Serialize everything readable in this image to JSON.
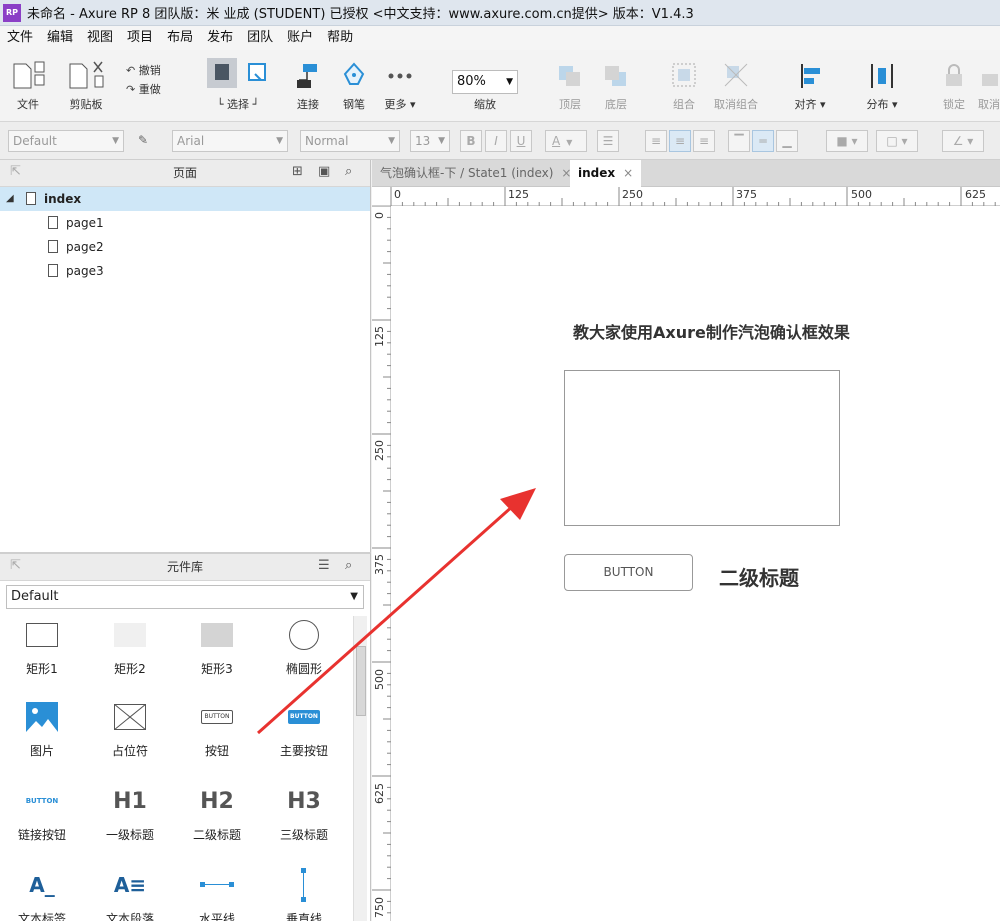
{
  "window": {
    "logo": "RP",
    "title": "未命名 - Axure RP 8 团队版：米 业成 (STUDENT) 已授权     <中文支持：www.axure.com.cn提供> 版本：V1.4.3"
  },
  "menu": [
    "文件",
    "编辑",
    "视图",
    "项目",
    "布局",
    "发布",
    "团队",
    "账户",
    "帮助"
  ],
  "toolbar": {
    "file": "文件",
    "clipboard": "剪贴板",
    "undo": "撤销",
    "redo": "重做",
    "select": "选择",
    "connect": "连接",
    "pen": "钢笔",
    "more": "更多 ▾",
    "zoom_value": "80%",
    "zoom_label": "缩放",
    "top": "顶层",
    "bottom": "底层",
    "group": "组合",
    "ungroup": "取消组合",
    "align": "对齐 ▾",
    "distribute": "分布 ▾",
    "lock": "锁定",
    "unlock": "取消"
  },
  "format": {
    "style": "Default",
    "font": "Arial",
    "weight": "Normal",
    "size": "13",
    "bold": "B",
    "italic": "I",
    "underline": "U",
    "font_color": "A"
  },
  "pages_panel": {
    "title": "页面",
    "root": "index",
    "children": [
      "page1",
      "page2",
      "page3"
    ]
  },
  "library_panel": {
    "title": "元件库",
    "selected_library": "Default",
    "widgets": [
      {
        "label": "矩形1",
        "icon": "rectangle-icon"
      },
      {
        "label": "矩形2",
        "icon": "rectangle-light-icon"
      },
      {
        "label": "矩形3",
        "icon": "rectangle-gray-icon"
      },
      {
        "label": "椭圆形",
        "icon": "ellipse-icon"
      },
      {
        "label": "图片",
        "icon": "image-icon"
      },
      {
        "label": "占位符",
        "icon": "placeholder-icon"
      },
      {
        "label": "按钮",
        "icon": "button-icon"
      },
      {
        "label": "主要按钮",
        "icon": "primary-button-icon"
      },
      {
        "label": "链接按钮",
        "icon": "link-button-icon"
      },
      {
        "label": "一级标题",
        "icon": "h1-icon"
      },
      {
        "label": "二级标题",
        "icon": "h2-icon"
      },
      {
        "label": "三级标题",
        "icon": "h3-icon"
      },
      {
        "label": "文本标签",
        "icon": "text-label-icon"
      },
      {
        "label": "文本段落",
        "icon": "text-paragraph-icon"
      },
      {
        "label": "水平线",
        "icon": "horizontal-line-icon"
      },
      {
        "label": "垂直线",
        "icon": "vertical-line-icon"
      }
    ],
    "widget_icon_text": {
      "button": "BUTTON",
      "h1": "H1",
      "h2": "H2",
      "h3": "H3",
      "text_label": "A_",
      "text_paragraph": "A≡"
    }
  },
  "tabs": [
    {
      "label": "气泡确认框-下 / State1 (index)",
      "close": "×"
    },
    {
      "label": "index",
      "close": "×"
    }
  ],
  "rulers": {
    "h_ticks": [
      "0",
      "125",
      "250",
      "375",
      "500",
      "625"
    ],
    "v_ticks": [
      "0",
      "125",
      "250",
      "375",
      "500",
      "625",
      "750"
    ]
  },
  "canvas": {
    "title": "教大家使用Axure制作汽泡确认框效果",
    "button_label": "BUTTON",
    "heading2": "二级标题"
  },
  "colors": {
    "accent_blue": "#2a8fd6",
    "arrow_red": "#e8322f",
    "selected_row": "#cfe7f7"
  }
}
